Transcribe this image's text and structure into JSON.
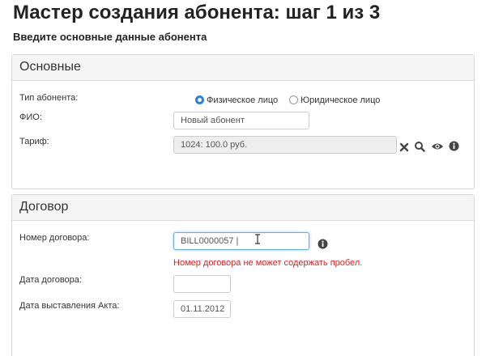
{
  "header": {
    "title": "Мастер создания абонента: шаг 1 из 3",
    "subtitle": "Введите основные данные абонента"
  },
  "main_panel": {
    "heading": "Основные",
    "subscriber_type": {
      "label": "Тип абонента:",
      "options": [
        {
          "label": "Физическое лицо",
          "checked": true
        },
        {
          "label": "Юридическое лицо",
          "checked": false
        }
      ]
    },
    "fio": {
      "label": "ФИО:",
      "value": "Новый абонент"
    },
    "tariff": {
      "label": "Тариф:",
      "value": "1024: 100.0 руб.",
      "icons": [
        "clear-icon",
        "search-icon",
        "eye-icon",
        "info-icon"
      ]
    }
  },
  "contract_panel": {
    "heading": "Договор",
    "contract_number": {
      "label": "Номер договора:",
      "value": "BILL0000057 |",
      "error": "Номер договора не может содержать пробел."
    },
    "contract_date": {
      "label": "Дата договора:",
      "value": ""
    },
    "act_date": {
      "label": "Дата выставления Акта:",
      "value": "01.11.2012"
    }
  },
  "colors": {
    "accent": "#2d7fe0",
    "error": "#e02020",
    "panel_heading_bg": "#f5f5f5",
    "readonly_bg": "#eeeeee",
    "focus_border": "#66afe9"
  }
}
